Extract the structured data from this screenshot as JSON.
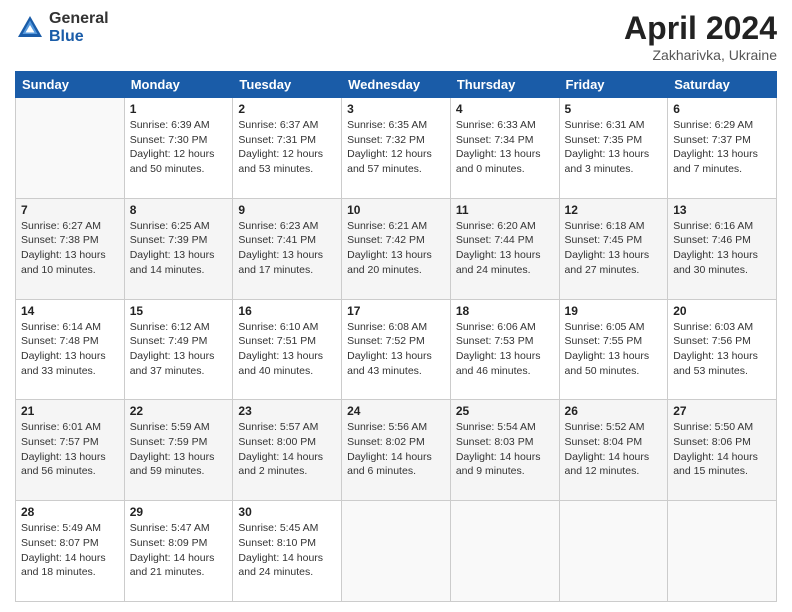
{
  "header": {
    "logo_general": "General",
    "logo_blue": "Blue",
    "month_title": "April 2024",
    "location": "Zakharivka, Ukraine"
  },
  "weekdays": [
    "Sunday",
    "Monday",
    "Tuesday",
    "Wednesday",
    "Thursday",
    "Friday",
    "Saturday"
  ],
  "weeks": [
    [
      {
        "day": "",
        "info": ""
      },
      {
        "day": "1",
        "info": "Sunrise: 6:39 AM\nSunset: 7:30 PM\nDaylight: 12 hours\nand 50 minutes."
      },
      {
        "day": "2",
        "info": "Sunrise: 6:37 AM\nSunset: 7:31 PM\nDaylight: 12 hours\nand 53 minutes."
      },
      {
        "day": "3",
        "info": "Sunrise: 6:35 AM\nSunset: 7:32 PM\nDaylight: 12 hours\nand 57 minutes."
      },
      {
        "day": "4",
        "info": "Sunrise: 6:33 AM\nSunset: 7:34 PM\nDaylight: 13 hours\nand 0 minutes."
      },
      {
        "day": "5",
        "info": "Sunrise: 6:31 AM\nSunset: 7:35 PM\nDaylight: 13 hours\nand 3 minutes."
      },
      {
        "day": "6",
        "info": "Sunrise: 6:29 AM\nSunset: 7:37 PM\nDaylight: 13 hours\nand 7 minutes."
      }
    ],
    [
      {
        "day": "7",
        "info": "Sunrise: 6:27 AM\nSunset: 7:38 PM\nDaylight: 13 hours\nand 10 minutes."
      },
      {
        "day": "8",
        "info": "Sunrise: 6:25 AM\nSunset: 7:39 PM\nDaylight: 13 hours\nand 14 minutes."
      },
      {
        "day": "9",
        "info": "Sunrise: 6:23 AM\nSunset: 7:41 PM\nDaylight: 13 hours\nand 17 minutes."
      },
      {
        "day": "10",
        "info": "Sunrise: 6:21 AM\nSunset: 7:42 PM\nDaylight: 13 hours\nand 20 minutes."
      },
      {
        "day": "11",
        "info": "Sunrise: 6:20 AM\nSunset: 7:44 PM\nDaylight: 13 hours\nand 24 minutes."
      },
      {
        "day": "12",
        "info": "Sunrise: 6:18 AM\nSunset: 7:45 PM\nDaylight: 13 hours\nand 27 minutes."
      },
      {
        "day": "13",
        "info": "Sunrise: 6:16 AM\nSunset: 7:46 PM\nDaylight: 13 hours\nand 30 minutes."
      }
    ],
    [
      {
        "day": "14",
        "info": "Sunrise: 6:14 AM\nSunset: 7:48 PM\nDaylight: 13 hours\nand 33 minutes."
      },
      {
        "day": "15",
        "info": "Sunrise: 6:12 AM\nSunset: 7:49 PM\nDaylight: 13 hours\nand 37 minutes."
      },
      {
        "day": "16",
        "info": "Sunrise: 6:10 AM\nSunset: 7:51 PM\nDaylight: 13 hours\nand 40 minutes."
      },
      {
        "day": "17",
        "info": "Sunrise: 6:08 AM\nSunset: 7:52 PM\nDaylight: 13 hours\nand 43 minutes."
      },
      {
        "day": "18",
        "info": "Sunrise: 6:06 AM\nSunset: 7:53 PM\nDaylight: 13 hours\nand 46 minutes."
      },
      {
        "day": "19",
        "info": "Sunrise: 6:05 AM\nSunset: 7:55 PM\nDaylight: 13 hours\nand 50 minutes."
      },
      {
        "day": "20",
        "info": "Sunrise: 6:03 AM\nSunset: 7:56 PM\nDaylight: 13 hours\nand 53 minutes."
      }
    ],
    [
      {
        "day": "21",
        "info": "Sunrise: 6:01 AM\nSunset: 7:57 PM\nDaylight: 13 hours\nand 56 minutes."
      },
      {
        "day": "22",
        "info": "Sunrise: 5:59 AM\nSunset: 7:59 PM\nDaylight: 13 hours\nand 59 minutes."
      },
      {
        "day": "23",
        "info": "Sunrise: 5:57 AM\nSunset: 8:00 PM\nDaylight: 14 hours\nand 2 minutes."
      },
      {
        "day": "24",
        "info": "Sunrise: 5:56 AM\nSunset: 8:02 PM\nDaylight: 14 hours\nand 6 minutes."
      },
      {
        "day": "25",
        "info": "Sunrise: 5:54 AM\nSunset: 8:03 PM\nDaylight: 14 hours\nand 9 minutes."
      },
      {
        "day": "26",
        "info": "Sunrise: 5:52 AM\nSunset: 8:04 PM\nDaylight: 14 hours\nand 12 minutes."
      },
      {
        "day": "27",
        "info": "Sunrise: 5:50 AM\nSunset: 8:06 PM\nDaylight: 14 hours\nand 15 minutes."
      }
    ],
    [
      {
        "day": "28",
        "info": "Sunrise: 5:49 AM\nSunset: 8:07 PM\nDaylight: 14 hours\nand 18 minutes."
      },
      {
        "day": "29",
        "info": "Sunrise: 5:47 AM\nSunset: 8:09 PM\nDaylight: 14 hours\nand 21 minutes."
      },
      {
        "day": "30",
        "info": "Sunrise: 5:45 AM\nSunset: 8:10 PM\nDaylight: 14 hours\nand 24 minutes."
      },
      {
        "day": "",
        "info": ""
      },
      {
        "day": "",
        "info": ""
      },
      {
        "day": "",
        "info": ""
      },
      {
        "day": "",
        "info": ""
      }
    ]
  ]
}
